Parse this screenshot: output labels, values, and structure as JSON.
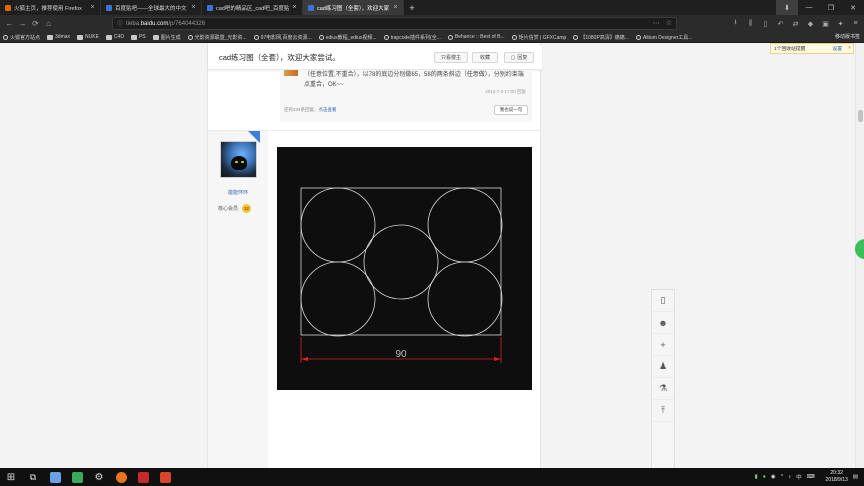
{
  "browser": {
    "tabs": [
      {
        "label": "火狐主页，推荐使用 Firefox",
        "color": "#e66000",
        "active": false
      },
      {
        "label": "百度贴吧——全球最大的中文",
        "color": "#3a75d6",
        "active": false
      },
      {
        "label": "cad吧的精品区_cad吧_百度贴",
        "color": "#3a75d6",
        "active": false
      },
      {
        "label": "cad练习图（全套），欢迎大家",
        "color": "#3a75d6",
        "active": true
      },
      {
        "label": "",
        "color": "#3a75d6",
        "active": false
      }
    ],
    "url_prefix": "tieba.",
    "url_host": "baidu.com",
    "url_path": "/p/764044326",
    "bookmarks": [
      {
        "label": "火狐官方站点",
        "kind": "dot"
      },
      {
        "label": "3dmax",
        "kind": "folder"
      },
      {
        "label": "NUKE",
        "kind": "folder"
      },
      {
        "label": "C4D",
        "kind": "folder"
      },
      {
        "label": "PS",
        "kind": "folder"
      },
      {
        "label": "图片生成",
        "kind": "folder"
      },
      {
        "label": "光影资源联盟_光影资...",
        "kind": "dot"
      },
      {
        "label": "97电影网,百度云资源...",
        "kind": "dot"
      },
      {
        "label": "edius教程_edius视频...",
        "kind": "dot"
      },
      {
        "label": "trapcode插件系列(全...",
        "kind": "dot"
      },
      {
        "label": "Behance :: Best of B...",
        "kind": "dot"
      },
      {
        "label": "矩片信赏 | GFXCamp",
        "kind": "dot"
      },
      {
        "label": "【1080P高清】痛痛...",
        "kind": "dot"
      },
      {
        "label": "Altium Designer工具...",
        "kind": "dot"
      }
    ],
    "bookmarks_right": "移动版书签"
  },
  "notify": {
    "text": "1个回收站提醒",
    "settings": "设置",
    "close": "×"
  },
  "thread": {
    "title": "cad练习图（全套），欢迎大家尝试。",
    "only_author": "只看楼主",
    "favorite": "收藏",
    "reply": "回复"
  },
  "reply": {
    "text": "（任意位置,不重合），以78的底边分别做65，58的两条斜边（任意做），分别约束端点重合，OK~~",
    "meta": "2012-7-3 17:00  回复",
    "more_prefix": "还有234条回复，",
    "more_link": "点击查看",
    "say_btn": "我也说一句"
  },
  "user": {
    "name": "能能环环",
    "rank": "核心会员",
    "level": "12"
  },
  "cad": {
    "dimension": "90",
    "line_color": "#d8d8d8",
    "dim_color": "#e02020"
  },
  "taskbar": {
    "time": "20:32",
    "date": "2018/9/13"
  }
}
